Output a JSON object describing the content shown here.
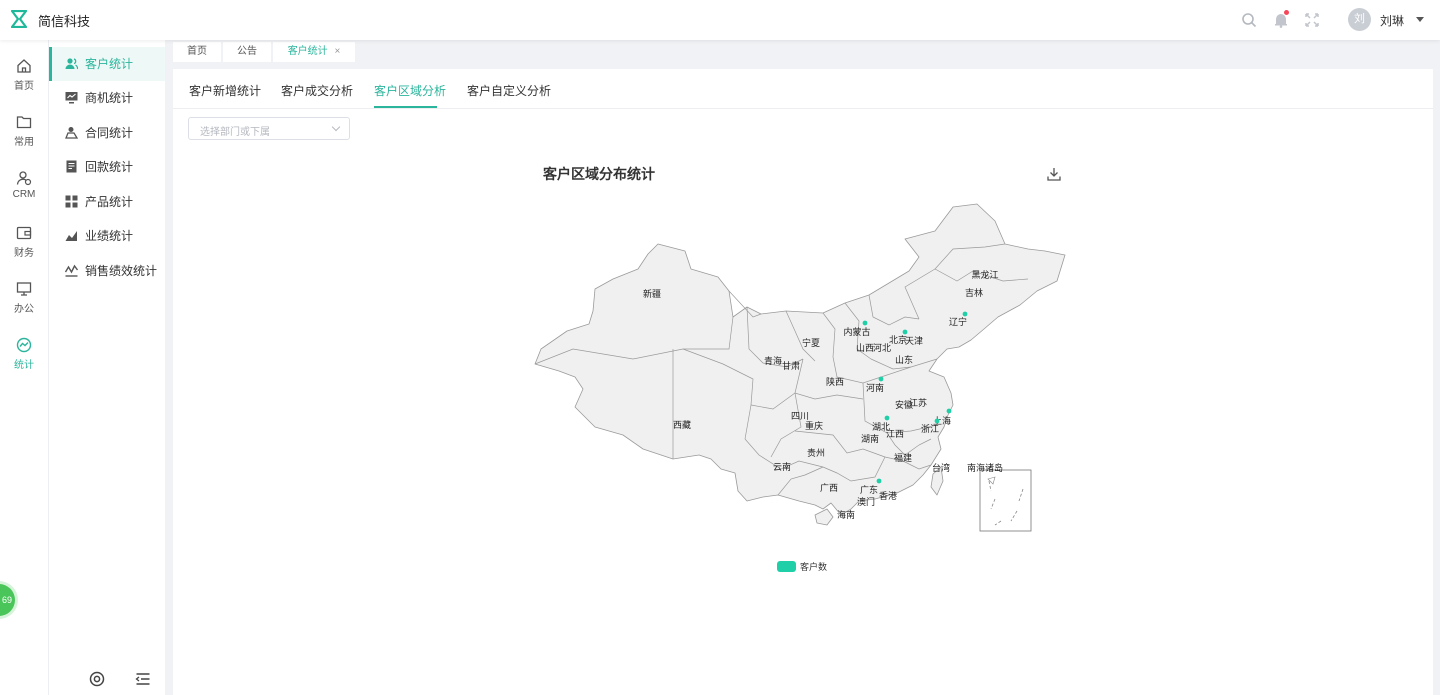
{
  "brand": {
    "name": "简信科技"
  },
  "header": {
    "user_name": "刘琳",
    "avatar_text": "刘"
  },
  "rail": [
    {
      "label": "首页",
      "icon": "home-icon"
    },
    {
      "label": "常用",
      "icon": "folder-icon"
    },
    {
      "label": "CRM",
      "icon": "crm-icon"
    },
    {
      "label": "财务",
      "icon": "wallet-icon"
    },
    {
      "label": "办公",
      "icon": "monitor-icon"
    },
    {
      "label": "统计",
      "icon": "stats-icon",
      "active": true
    }
  ],
  "subnav": [
    {
      "label": "客户统计",
      "active": true
    },
    {
      "label": "商机统计"
    },
    {
      "label": "合同统计"
    },
    {
      "label": "回款统计"
    },
    {
      "label": "产品统计"
    },
    {
      "label": "业绩统计"
    },
    {
      "label": "销售绩效统计"
    }
  ],
  "page_tabs": [
    {
      "label": "首页"
    },
    {
      "label": "公告"
    },
    {
      "label": "客户统计",
      "active": true,
      "close": "×"
    }
  ],
  "content_tabs": [
    {
      "label": "客户新增统计"
    },
    {
      "label": "客户成交分析"
    },
    {
      "label": "客户区域分析",
      "active": true
    },
    {
      "label": "客户自定义分析"
    }
  ],
  "filter": {
    "placeholder": "选择部门或下属"
  },
  "chart": {
    "title": "客户区域分布统计",
    "legend": "客户数",
    "accent": "#1fcfa8",
    "inset_label": "南海诸岛"
  },
  "chart_data": {
    "type": "map",
    "title": "客户区域分布统计",
    "legend": [
      "客户数"
    ],
    "regions": [
      "新疆",
      "西藏",
      "青海",
      "甘肃",
      "宁夏",
      "内蒙古",
      "山西",
      "河北",
      "北京",
      "天津",
      "辽宁",
      "吉林",
      "黑龙江",
      "山东",
      "河南",
      "陕西",
      "四川",
      "重庆",
      "湖北",
      "安徽",
      "江苏",
      "上海",
      "浙江",
      "江西",
      "湖南",
      "贵州",
      "云南",
      "广西",
      "广东",
      "福建",
      "台湾",
      "香港",
      "澳门",
      "海南"
    ],
    "marked_regions": [
      "内蒙古",
      "北京",
      "辽宁",
      "河南",
      "湖北",
      "浙江",
      "上海",
      "广东"
    ]
  },
  "float_badge": "69",
  "colors": {
    "accent": "#2bb59c",
    "map_fill": "#f0f0f0",
    "map_stroke": "#9a9a9a"
  }
}
